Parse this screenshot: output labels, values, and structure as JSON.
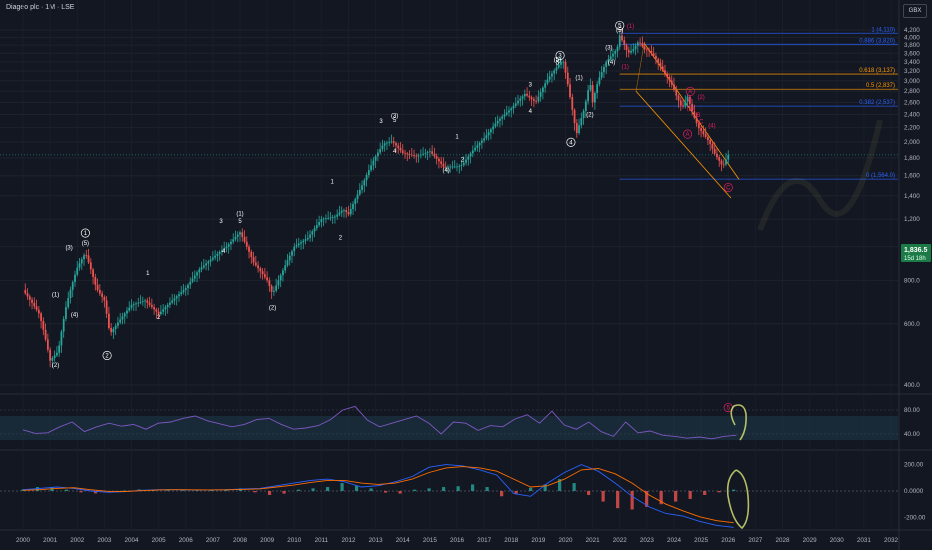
{
  "header": {
    "title": "Diageo plc · 1M · LSE",
    "currency": "GBX"
  },
  "price_badge": {
    "price": "1,836.5",
    "countdown": "15d 18h"
  },
  "chart_data": [
    {
      "type": "candlestick",
      "name": "Price",
      "x_ticks": [
        "2000",
        "2001",
        "2002",
        "2003",
        "2004",
        "2005",
        "2006",
        "2007",
        "2008",
        "2009",
        "2010",
        "2011",
        "2012",
        "2013",
        "2014",
        "2015",
        "2016",
        "2017",
        "2018",
        "2019",
        "2020",
        "2021",
        "2022",
        "2023",
        "2024",
        "2025",
        "2026",
        "2027",
        "2028",
        "2029",
        "2030",
        "2031",
        "2032"
      ],
      "y_ticks": [
        "4,200",
        "4,000",
        "3,800",
        "3,600",
        "3,400",
        "3,200",
        "3,000",
        "2,800",
        "2,600",
        "2,400",
        "2,200",
        "2,000",
        "1,800",
        "1,600",
        "1,400",
        "1,200",
        "1,000.0",
        "800.0",
        "600.0",
        "400.0"
      ],
      "ylim": [
        380,
        4250
      ],
      "price_path": [
        [
          2000.0,
          750
        ],
        [
          2000.6,
          640
        ],
        [
          2001.0,
          470
        ],
        [
          2001.3,
          500
        ],
        [
          2001.6,
          680
        ],
        [
          2002.0,
          870
        ],
        [
          2002.3,
          960
        ],
        [
          2002.7,
          760
        ],
        [
          2003.0,
          700
        ],
        [
          2003.2,
          560
        ],
        [
          2003.6,
          620
        ],
        [
          2004.0,
          680
        ],
        [
          2004.5,
          700
        ],
        [
          2005.0,
          640
        ],
        [
          2005.5,
          700
        ],
        [
          2006.0,
          760
        ],
        [
          2006.5,
          860
        ],
        [
          2007.0,
          930
        ],
        [
          2007.5,
          1000
        ],
        [
          2007.8,
          1060
        ],
        [
          2008.0,
          1100
        ],
        [
          2008.5,
          900
        ],
        [
          2009.0,
          800
        ],
        [
          2009.2,
          730
        ],
        [
          2009.6,
          860
        ],
        [
          2010.0,
          1000
        ],
        [
          2010.5,
          1060
        ],
        [
          2011.0,
          1200
        ],
        [
          2011.5,
          1220
        ],
        [
          2011.8,
          1280
        ],
        [
          2012.0,
          1240
        ],
        [
          2012.5,
          1500
        ],
        [
          2013.0,
          1820
        ],
        [
          2013.3,
          1980
        ],
        [
          2013.6,
          2010
        ],
        [
          2014.0,
          1860
        ],
        [
          2014.5,
          1820
        ],
        [
          2015.0,
          1880
        ],
        [
          2015.5,
          1700
        ],
        [
          2016.0,
          1700
        ],
        [
          2016.2,
          1720
        ],
        [
          2016.6,
          1900
        ],
        [
          2017.0,
          2050
        ],
        [
          2017.5,
          2300
        ],
        [
          2018.0,
          2500
        ],
        [
          2018.5,
          2750
        ],
        [
          2018.9,
          2600
        ],
        [
          2019.3,
          3000
        ],
        [
          2019.7,
          3300
        ],
        [
          2019.9,
          3450
        ],
        [
          2020.2,
          2600
        ],
        [
          2020.4,
          2100
        ],
        [
          2020.7,
          2500
        ],
        [
          2020.9,
          2980
        ],
        [
          2021.0,
          2600
        ],
        [
          2021.2,
          3000
        ],
        [
          2021.5,
          3400
        ],
        [
          2021.9,
          3700
        ],
        [
          2022.0,
          4050
        ],
        [
          2022.3,
          3600
        ],
        [
          2022.5,
          3700
        ],
        [
          2022.7,
          3900
        ],
        [
          2022.9,
          3700
        ],
        [
          2023.1,
          3650
        ],
        [
          2023.3,
          3500
        ],
        [
          2023.6,
          3200
        ],
        [
          2023.9,
          2950
        ],
        [
          2024.1,
          2700
        ],
        [
          2024.3,
          2500
        ],
        [
          2024.5,
          2700
        ],
        [
          2024.7,
          2400
        ],
        [
          2024.9,
          2200
        ],
        [
          2025.1,
          2100
        ],
        [
          2025.3,
          2000
        ],
        [
          2025.5,
          1850
        ],
        [
          2025.8,
          1700
        ],
        [
          2026.0,
          1836.5
        ]
      ],
      "fib_levels": [
        {
          "label": "1 (4,110)",
          "value": 4110,
          "color": "#2962ff"
        },
        {
          "label": "0.886 (3,820)",
          "value": 3820,
          "color": "#2962ff"
        },
        {
          "label": "0.618 (3,137)",
          "value": 3137,
          "color": "#ff9800"
        },
        {
          "label": "0.5 (2,837)",
          "value": 2837,
          "color": "#ff9800"
        },
        {
          "label": "0.382 (2,537)",
          "value": 2537,
          "color": "#2962ff"
        },
        {
          "label": "0 (1,564.0)",
          "value": 1564,
          "color": "#2962ff"
        }
      ],
      "wave_labels": [
        {
          "t": "(1)",
          "x": 2001.2,
          "y": 720
        },
        {
          "t": "(2)",
          "x": 2001.2,
          "y": 450
        },
        {
          "t": "(3)",
          "x": 2001.7,
          "y": 980
        },
        {
          "t": "(4)",
          "x": 2001.9,
          "y": 630
        },
        {
          "t": "1",
          "x": 2002.3,
          "y": 1080,
          "c": 1
        },
        {
          "t": "(5)",
          "x": 2002.3,
          "y": 1010
        },
        {
          "t": "2",
          "x": 2003.1,
          "y": 480,
          "c": 1
        },
        {
          "t": "1",
          "x": 2004.6,
          "y": 830
        },
        {
          "t": "2",
          "x": 2005.0,
          "y": 620
        },
        {
          "t": "3",
          "x": 2007.3,
          "y": 1170
        },
        {
          "t": "4",
          "x": 2007.4,
          "y": 960
        },
        {
          "t": "(1)",
          "x": 2008.0,
          "y": 1230
        },
        {
          "t": "5",
          "x": 2008.0,
          "y": 1170
        },
        {
          "t": "(2)",
          "x": 2009.2,
          "y": 660
        },
        {
          "t": "1",
          "x": 2011.4,
          "y": 1520
        },
        {
          "t": "2",
          "x": 2011.7,
          "y": 1050
        },
        {
          "t": "3",
          "x": 2013.2,
          "y": 2270
        },
        {
          "t": "(3)",
          "x": 2013.7,
          "y": 2350
        },
        {
          "t": "5",
          "x": 2013.7,
          "y": 2280
        },
        {
          "t": "4",
          "x": 2013.7,
          "y": 1860
        },
        {
          "t": "1",
          "x": 2016.0,
          "y": 2050
        },
        {
          "t": "2",
          "x": 2016.2,
          "y": 1760
        },
        {
          "t": "(4)",
          "x": 2015.6,
          "y": 1640
        },
        {
          "t": "3",
          "x": 2018.7,
          "y": 2890
        },
        {
          "t": "4",
          "x": 2018.7,
          "y": 2420
        },
        {
          "t": "(5)",
          "x": 2019.7,
          "y": 3410
        },
        {
          "t": "5",
          "x": 2019.7,
          "y": 3340
        },
        {
          "t": "3",
          "x": 2019.8,
          "y": 3500,
          "c": 1
        },
        {
          "t": "(1)",
          "x": 2020.5,
          "y": 3030
        },
        {
          "t": "(2)",
          "x": 2020.9,
          "y": 2370
        },
        {
          "t": "4",
          "x": 2020.2,
          "y": 1970,
          "c": 1
        },
        {
          "t": "(3)",
          "x": 2021.6,
          "y": 3690
        },
        {
          "t": "(4)",
          "x": 2021.7,
          "y": 3350
        },
        {
          "t": "5",
          "x": 2022.0,
          "y": 4270,
          "c": 1
        },
        {
          "t": "(5)",
          "x": 2022.0,
          "y": 4150
        }
      ],
      "correction_labels": [
        {
          "t": "(1)",
          "x": 2022.4,
          "y": 4250
        },
        {
          "t": "(1)",
          "x": 2022.2,
          "y": 3250
        },
        {
          "t": "A",
          "x": 2024.6,
          "y": 2760,
          "c": 1
        },
        {
          "t": "A",
          "x": 2024.6,
          "y": 2620
        },
        {
          "t": "(2)",
          "x": 2024.6,
          "y": 2470
        },
        {
          "t": "(2)",
          "x": 2025.0,
          "y": 2660
        },
        {
          "t": "B",
          "x": 2024.9,
          "y": 2360
        },
        {
          "t": "C",
          "x": 2025.0,
          "y": 2260
        },
        {
          "t": "A",
          "x": 2024.5,
          "y": 2080,
          "c": 1
        },
        {
          "t": "(4)",
          "x": 2025.4,
          "y": 2200
        },
        {
          "t": "C",
          "x": 2026.0,
          "y": 1460,
          "c": 1
        },
        {
          "t": "5",
          "x": 2026.0,
          "y": 340,
          "c": 1
        }
      ]
    },
    {
      "type": "line",
      "name": "RSI",
      "y_ticks": [
        "80.00",
        "40.00"
      ],
      "ylim": [
        20,
        100
      ],
      "band": [
        30,
        70
      ],
      "values": [
        47,
        41,
        42,
        52,
        60,
        44,
        52,
        58,
        53,
        56,
        48,
        58,
        60,
        66,
        70,
        62,
        57,
        52,
        56,
        64,
        66,
        56,
        48,
        50,
        54,
        64,
        80,
        86,
        63,
        52,
        58,
        64,
        70,
        58,
        40,
        60,
        58,
        46,
        54,
        52,
        65,
        72,
        58,
        78,
        55,
        48,
        60,
        44,
        36,
        60,
        42,
        45,
        38,
        36,
        33,
        35,
        32,
        36,
        38
      ]
    },
    {
      "type": "bar",
      "name": "MACD",
      "y_ticks": [
        "200.00",
        "0.0000",
        "-200.00"
      ],
      "ylim": [
        -280,
        280
      ],
      "hist": [
        12,
        30,
        28,
        10,
        -10,
        -18,
        -8,
        4,
        12,
        10,
        6,
        4,
        6,
        10,
        12,
        20,
        -10,
        -30,
        -20,
        10,
        20,
        30,
        60,
        40,
        20,
        -12,
        -20,
        10,
        20,
        30,
        36,
        50,
        30,
        -40,
        -20,
        24,
        50,
        90,
        60,
        -30,
        -80,
        -130,
        -140,
        -120,
        -100,
        -80,
        -60,
        -30,
        -10,
        10
      ],
      "macd": [
        10,
        20,
        30,
        20,
        0,
        -10,
        -5,
        5,
        10,
        10,
        8,
        8,
        10,
        15,
        20,
        40,
        60,
        80,
        90,
        70,
        30,
        40,
        70,
        110,
        180,
        200,
        190,
        160,
        120,
        -20,
        -40,
        60,
        140,
        200,
        150,
        60,
        -40,
        -120,
        -170,
        -190,
        -230,
        -260,
        -275
      ],
      "signal": [
        5,
        10,
        20,
        25,
        10,
        -2,
        -4,
        2,
        8,
        10,
        9,
        8,
        9,
        12,
        16,
        30,
        45,
        65,
        80,
        80,
        60,
        50,
        60,
        90,
        140,
        175,
        185,
        175,
        150,
        90,
        30,
        40,
        90,
        160,
        170,
        130,
        60,
        -30,
        -100,
        -150,
        -195,
        -225,
        -240
      ]
    }
  ]
}
